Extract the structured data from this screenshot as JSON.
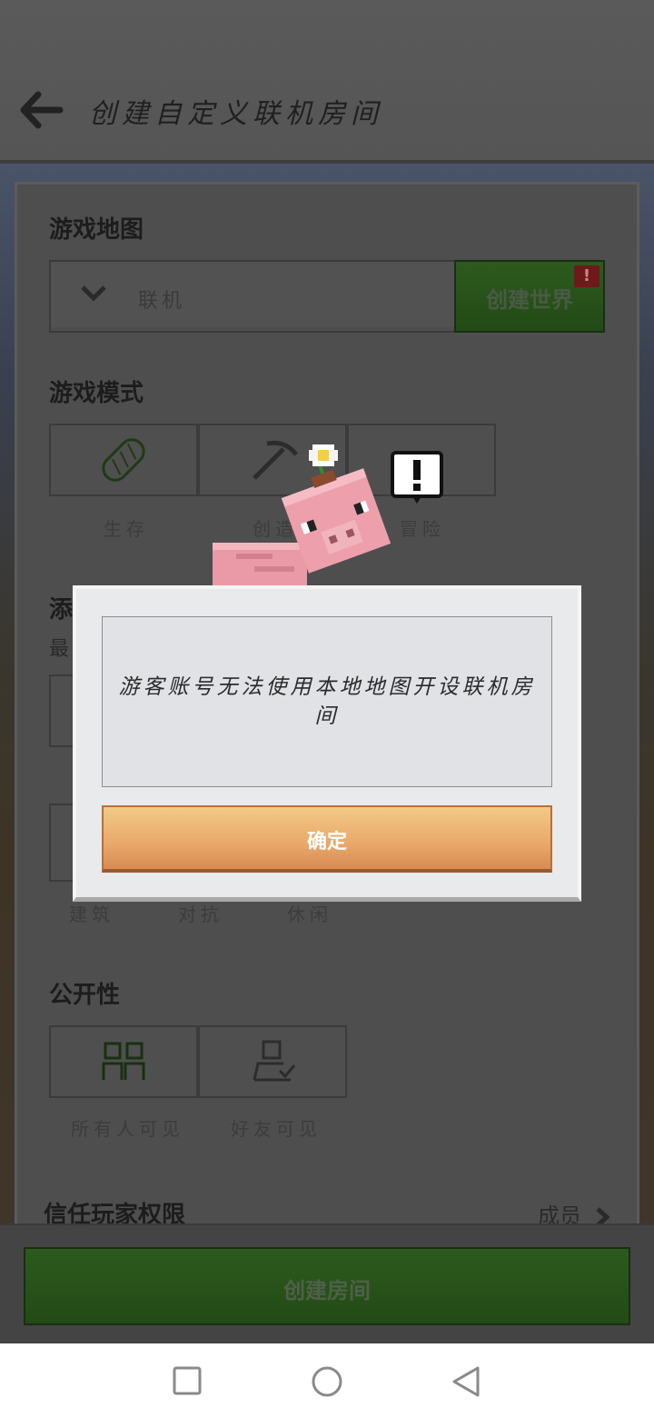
{
  "header": {
    "title": "创建自定义联机房间"
  },
  "map_section": {
    "title": "游戏地图",
    "selected_map": "联机",
    "create_world_label": "创建世界",
    "warning_badge": "!"
  },
  "mode_section": {
    "title": "游戏模式",
    "modes": [
      {
        "label": "生存",
        "icon": "bread-icon",
        "selected": true
      },
      {
        "label": "创造",
        "icon": "pickaxe-icon",
        "selected": false
      },
      {
        "label": "冒险",
        "icon": "alert-icon",
        "selected": false
      }
    ]
  },
  "addon_section": {
    "title_partial": "添",
    "subtitle_partial": "最",
    "tags": [
      "建筑",
      "对抗",
      "休闲"
    ]
  },
  "dialog": {
    "message": "游客账号无法使用本地地图开设联机房间",
    "confirm_label": "确定"
  },
  "visibility_section": {
    "title": "公开性",
    "options": [
      {
        "label": "所有人可见",
        "icon": "people-icon",
        "selected": true
      },
      {
        "label": "好友可见",
        "icon": "friend-icon",
        "selected": false
      }
    ]
  },
  "trusted": {
    "title": "信任玩家权限",
    "value": "成员"
  },
  "bottom": {
    "create_room_label": "创建房间"
  },
  "colors": {
    "accent_green": "#2d5a1e",
    "confirm_orange": "#e9a86a",
    "overlay": "#4e4e4e"
  }
}
